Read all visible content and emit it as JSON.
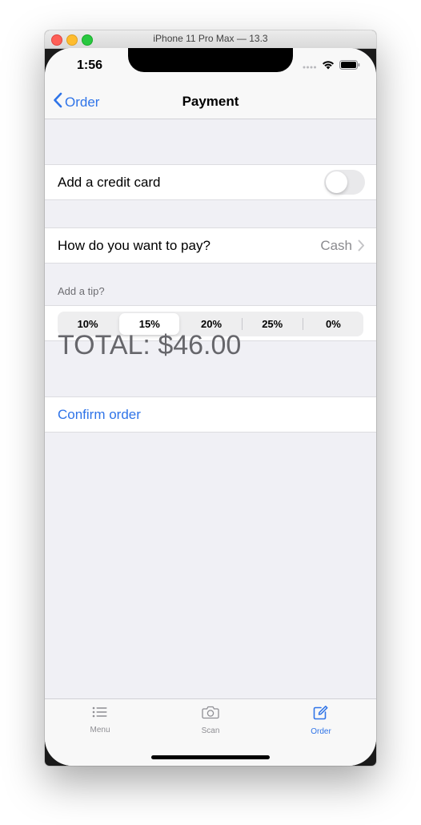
{
  "window": {
    "title": "iPhone 11 Pro Max — 13.3"
  },
  "status_bar": {
    "time": "1:56",
    "icons": [
      "signal-dots-icon",
      "wifi-icon",
      "battery-icon"
    ]
  },
  "nav": {
    "back_label": "Order",
    "title": "Payment"
  },
  "credit_card": {
    "label": "Add a credit card",
    "toggle_on": false
  },
  "payment_method": {
    "label": "How do you want to pay?",
    "value": "Cash"
  },
  "tip": {
    "header": "Add a tip?",
    "options": [
      "10%",
      "15%",
      "20%",
      "25%",
      "0%"
    ],
    "selected": "15%"
  },
  "total": {
    "text": "TOTAL: $46.00"
  },
  "confirm": {
    "label": "Confirm order"
  },
  "tabbar": {
    "items": [
      {
        "label": "Menu",
        "icon": "list-icon",
        "active": false
      },
      {
        "label": "Scan",
        "icon": "camera-icon",
        "active": false
      },
      {
        "label": "Order",
        "icon": "compose-icon",
        "active": true
      }
    ]
  },
  "colors": {
    "accent": "#2f74e8",
    "background": "#f0f0f5",
    "secondary_text": "#8a8a8e"
  }
}
